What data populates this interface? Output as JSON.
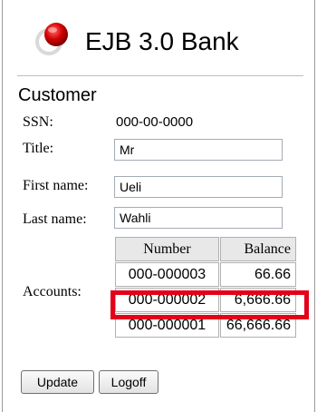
{
  "app": {
    "title": "EJB 3.0 Bank"
  },
  "section": {
    "title": "Customer"
  },
  "customer": {
    "ssn_label": "SSN:",
    "ssn_value": "000-00-0000",
    "title_label": "Title:",
    "title_value": "Mr",
    "first_name_label": "First name:",
    "first_name_value": "Ueli",
    "last_name_label": "Last name:",
    "last_name_value": "Wahli",
    "accounts_label": "Accounts:"
  },
  "accounts": {
    "headers": [
      "Number",
      "Balance"
    ],
    "rows": [
      {
        "number": "000-000003",
        "balance": "66.66"
      },
      {
        "number": "000-000002",
        "balance": "6,666.66"
      },
      {
        "number": "000-000001",
        "balance": "66,666.66"
      }
    ],
    "highlight_color": "#e40019"
  },
  "buttons": {
    "update": "Update",
    "logoff": "Logoff"
  }
}
